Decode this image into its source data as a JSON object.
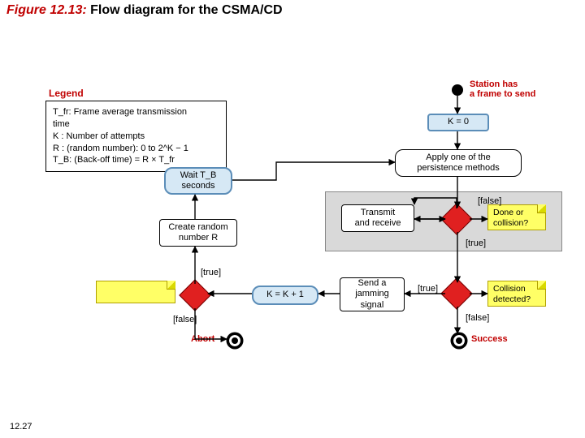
{
  "title": {
    "fig": "Figure 12.13:",
    "rest": "  Flow diagram for the CSMA/CD"
  },
  "page_number": "12.27",
  "legend": {
    "heading": "Legend",
    "l1": "T_fr:  Frame average transmission",
    "l1b": "         time",
    "l2": "K  :  Number of attempts",
    "l3": "R  :  (random number): 0 to 2^K − 1",
    "l4": "T_B:  (Back-off time) = R × T_fr"
  },
  "nodes": {
    "start_label": "Station has\na frame to send",
    "k0": "K = 0",
    "persist": "Apply one of the\npersistence methods",
    "tx": "Transmit\nand receive",
    "done_q": "Done or\ncollision?",
    "coll_q": "Collision\ndetected?",
    "jam": "Send a\njamming\nsignal",
    "kinc": "K = K + 1",
    "rand": "Create random\nnumber R",
    "wait": "Wait T_B\nseconds",
    "success": "Success",
    "abort": "Abort"
  },
  "edges": {
    "true": "[true]",
    "false": "[false]"
  }
}
